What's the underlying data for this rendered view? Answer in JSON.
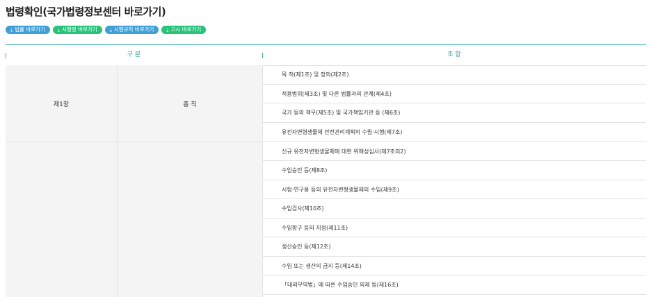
{
  "page": {
    "title": "법령확인(국가법령정보센터 바로가기)"
  },
  "links": [
    {
      "icon": "download-icon",
      "label": "법률 바로가기",
      "color": "#3f9fd6"
    },
    {
      "icon": "download-icon",
      "label": "시행령 바로가기",
      "color": "#29c27a"
    },
    {
      "icon": "download-icon",
      "label": "시행규칙 바로가기",
      "color": "#3f9fd6"
    },
    {
      "icon": "download-icon",
      "label": "고시 바로가기",
      "color": "#29c27a"
    }
  ],
  "table": {
    "header_color": "#36b4ad",
    "headers": {
      "gubun": "구 분",
      "jo": "조 항"
    },
    "groups": [
      {
        "chapter": "제1장",
        "section": "총 칙",
        "articles": [
          "목 적(제1조) 및 정의(제2조)",
          "적용범위(제3조) 및 다른 법률과의 관계(제4조)",
          "국가 등의 책무(제5조) 및 국가책임기관 등 (제6조)",
          "유전자변형생물체 안전관리계획의 수립·시행(제7조)"
        ]
      },
      {
        "chapter": "",
        "section": "",
        "articles": [
          "신규 유전자변형생물체에 대한 위해성심사(제7조의2)",
          "수입승인 등(제8조)",
          "시험·연구용 등의 유전자변형생물체의 수입(제9조)",
          "수입검사(제10조)",
          "수입항구 등의 지정(제11조)",
          "생산승인 등(제12조)",
          "수입 또는 생산의 금지 등(제14조)",
          "「대외무역법」에 따른 수입승인 의제 등(제16조)"
        ]
      }
    ]
  }
}
